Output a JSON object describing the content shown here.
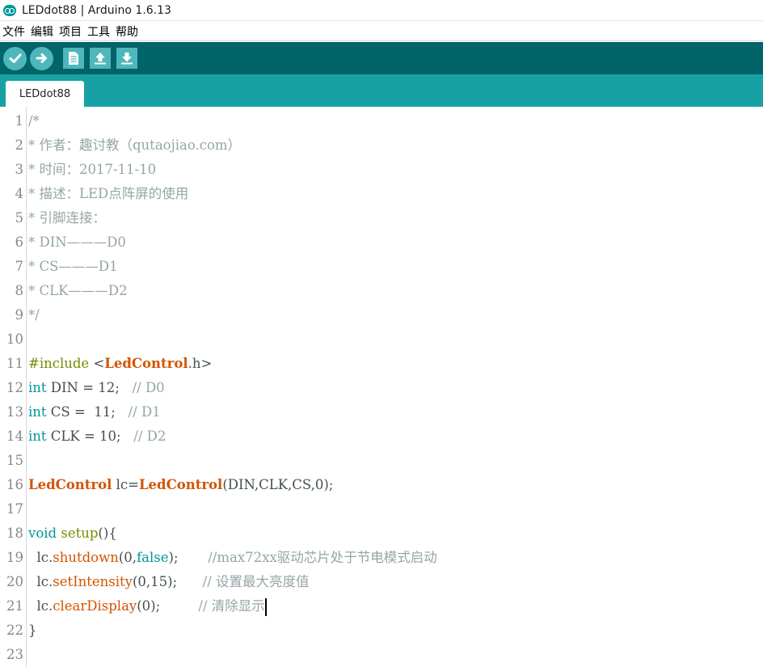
{
  "window": {
    "title": "LEDdot88 | Arduino 1.6.13"
  },
  "menu": [
    "文件",
    "编辑",
    "项目",
    "工具",
    "帮助"
  ],
  "toolbar": {
    "buttons": [
      "verify-icon",
      "upload-icon",
      "new-icon",
      "open-icon",
      "save-icon"
    ]
  },
  "tabs": [
    {
      "label": "LEDdot88"
    }
  ],
  "editor": {
    "lines": [
      {
        "n": "1",
        "t": "/*"
      },
      {
        "n": "2",
        "t": "* 作者：趣讨教（qutaojiao.com）"
      },
      {
        "n": "3",
        "t": "* 时间：2017-11-10"
      },
      {
        "n": "4",
        "t": "* 描述：LED点阵屏的使用"
      },
      {
        "n": "5",
        "t": "* 引脚连接："
      },
      {
        "n": "6",
        "t": "* DIN———D0"
      },
      {
        "n": "7",
        "t": "* CS———D1"
      },
      {
        "n": "8",
        "t": "* CLK———D2"
      },
      {
        "n": "9",
        "t": "*/"
      },
      {
        "n": "10",
        "t": ""
      },
      {
        "n": "11",
        "t": "#include <LedControl.h>"
      },
      {
        "n": "12",
        "t": "int DIN = 12;   // D0"
      },
      {
        "n": "13",
        "t": "int CS =  11;   // D1"
      },
      {
        "n": "14",
        "t": "int CLK = 10;   // D2"
      },
      {
        "n": "15",
        "t": ""
      },
      {
        "n": "16",
        "t": "LedControl lc=LedControl(DIN,CLK,CS,0);"
      },
      {
        "n": "17",
        "t": ""
      },
      {
        "n": "18",
        "t": "void setup(){"
      },
      {
        "n": "19",
        "t": "  lc.shutdown(0,false);       //max72xx驱动芯片处于节电模式启动"
      },
      {
        "n": "20",
        "t": "  lc.setIntensity(0,15);      // 设置最大亮度值"
      },
      {
        "n": "21",
        "t": "  lc.clearDisplay(0);         // 清除显示"
      },
      {
        "n": "22",
        "t": "}"
      },
      {
        "n": "23",
        "t": ""
      }
    ]
  },
  "colors": {
    "toolbar_bg": "#006468",
    "tabstrip_bg": "#17a1a5",
    "button_bg": "#4db7bb",
    "comment": "#95a5a6",
    "keyword": "#00979c",
    "class_name": "#d35400"
  }
}
